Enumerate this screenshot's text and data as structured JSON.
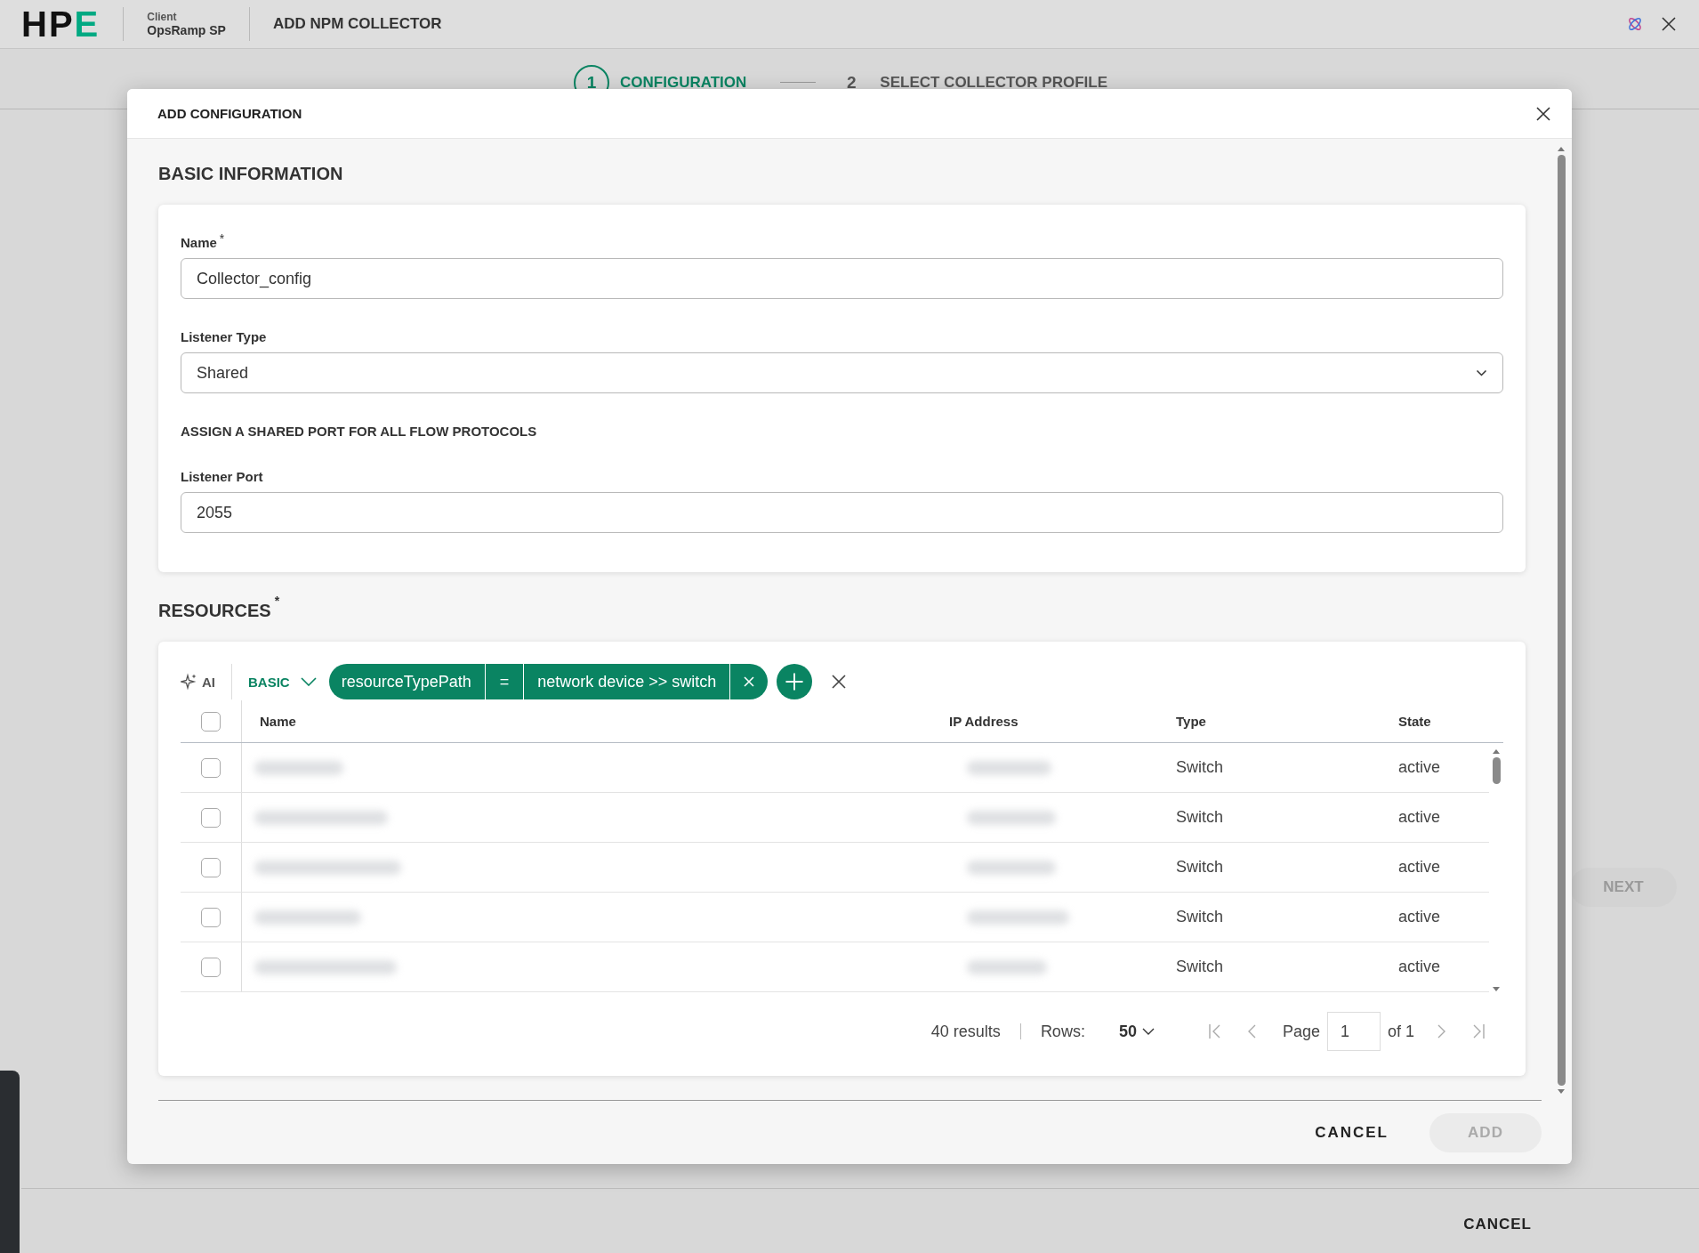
{
  "header": {
    "logo": "HPE",
    "client_label": "Client",
    "client_name": "OpsRamp SP",
    "title": "ADD NPM COLLECTOR"
  },
  "stepper": [
    {
      "number": "1",
      "label": "CONFIGURATION",
      "selected": true
    },
    {
      "number": "2",
      "label": "SELECT COLLECTOR PROFILE",
      "selected": false
    }
  ],
  "page_actions": {
    "next": {
      "label": "NEXT",
      "disabled": true
    },
    "cancel": "CANCEL"
  },
  "dialog": {
    "title": "ADD CONFIGURATION",
    "basic_heading": "BASIC INFORMATION",
    "fields": [
      {
        "kind": "input",
        "label": "Name",
        "required_mark": "*",
        "value": "Collector_config"
      },
      {
        "kind": "select",
        "label": "Listener Type",
        "value": "Shared"
      },
      {
        "kind": "note",
        "text": "ASSIGN A SHARED PORT FOR ALL FLOW PROTOCOLS"
      },
      {
        "kind": "input",
        "label": "Listener Port",
        "value": "2055"
      }
    ],
    "resources": {
      "heading": "RESOURCES",
      "required_mark": "*",
      "ai_label": "AI",
      "mode": "BASIC",
      "filter": {
        "field": "resourceTypePath",
        "operator": "=",
        "value": "network device >> switch"
      },
      "columns": [
        "Name",
        "IP Address",
        "Type",
        "State"
      ],
      "all_checked": false,
      "rows": [
        {
          "checked": false,
          "type": "Switch",
          "state": "active"
        },
        {
          "checked": false,
          "type": "Switch",
          "state": "active"
        },
        {
          "checked": false,
          "type": "Switch",
          "state": "active"
        },
        {
          "checked": false,
          "type": "Switch",
          "state": "active"
        },
        {
          "checked": false,
          "type": "Switch",
          "state": "active"
        }
      ],
      "pagination": {
        "results": "40 results",
        "rows_label": "Rows:",
        "rows_value": "50",
        "page_label": "Page",
        "page": "1",
        "of": "of 1"
      }
    },
    "cancel": "CANCEL",
    "add": {
      "label": "ADD",
      "disabled": true
    }
  }
}
